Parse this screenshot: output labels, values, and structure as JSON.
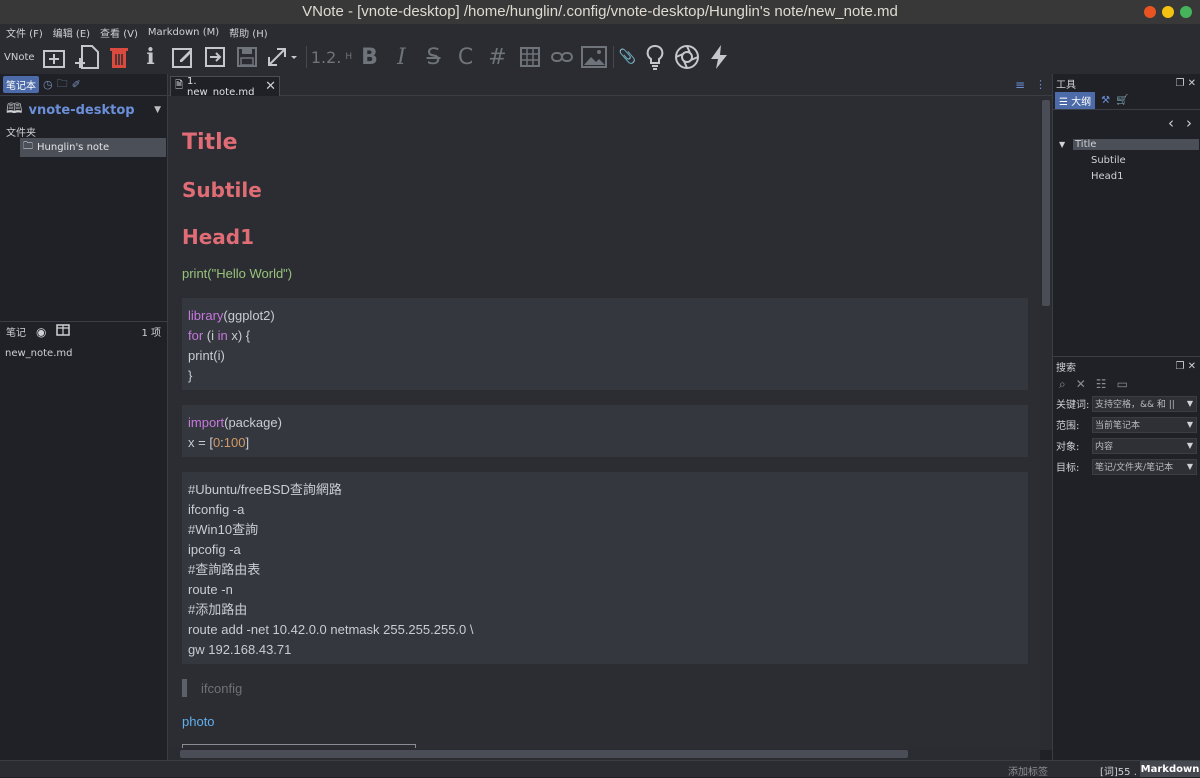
{
  "window": {
    "title": "VNote - [vnote-desktop] /home/hunglin/.config/vnote-desktop/Hunglin's note/new_note.md"
  },
  "menu": [
    "文件 (F)",
    "编辑 (E)",
    "查看 (V)",
    "Markdown (M)",
    "帮助 (H)"
  ],
  "toolbar": {
    "app_label": "VNote",
    "heading_label": "1.2.",
    "heading_h": "H",
    "bold": "B",
    "italic": "I",
    "strike": "S",
    "code": "C",
    "hash": "#"
  },
  "left_panel": {
    "tab_notebook": "笔记本",
    "notebook_name": "vnote-desktop",
    "folder_label": "文件夹",
    "folder_item": "Hunglin's note",
    "notes_label": "笔记",
    "notes_count": "1 项",
    "note_item": "new_note.md"
  },
  "editor_tab": {
    "label": "1. new_note.md"
  },
  "document": {
    "title": "Title",
    "subtitle": "Subtile",
    "head1": "Head1",
    "print_line": "print(\"Hello World\")",
    "block1": {
      "l1_kw": "library",
      "l1_rest": "(ggplot2)",
      "l2_kw1": "for",
      "l2_mid1": " (i ",
      "l2_kw2": "in",
      "l2_mid2": " x) {",
      "l3": "print(i)",
      "l4": "}"
    },
    "block2": {
      "l1_kw": "import",
      "l1_rest": "(package)",
      "l2_pre": "x = [",
      "l2_num1": "0",
      "l2_colon": ":",
      "l2_num2": "100",
      "l2_post": "]"
    },
    "block3": [
      "#Ubuntu/freeBSD查詢網路",
      "ifconfig -a",
      "#Win10查詢",
      "ipcofig -a",
      "#查詢路由表",
      "route -n",
      "#添加路由",
      "route add -net 10.42.0.0 netmask 255.255.255.0 \\",
      "gw 192.168.43.71"
    ],
    "quote": "ifconfig",
    "link": "photo"
  },
  "right_panel": {
    "tools_title": "工具",
    "outline_tab": "大纲",
    "outline": [
      "Title",
      "Subtile",
      "Head1"
    ],
    "search_title": "搜索",
    "search_fields": [
      {
        "label": "关键词:",
        "value": "支持空格，&& 和 ||"
      },
      {
        "label": "范围:",
        "value": "当前笔记本"
      },
      {
        "label": "对象:",
        "value": "内容"
      },
      {
        "label": "目标:",
        "value": "笔记/文件夹/笔记本"
      }
    ]
  },
  "status": {
    "add_tag": "添加标签",
    "words": "[词]55 .",
    "mode": "Markdown"
  }
}
